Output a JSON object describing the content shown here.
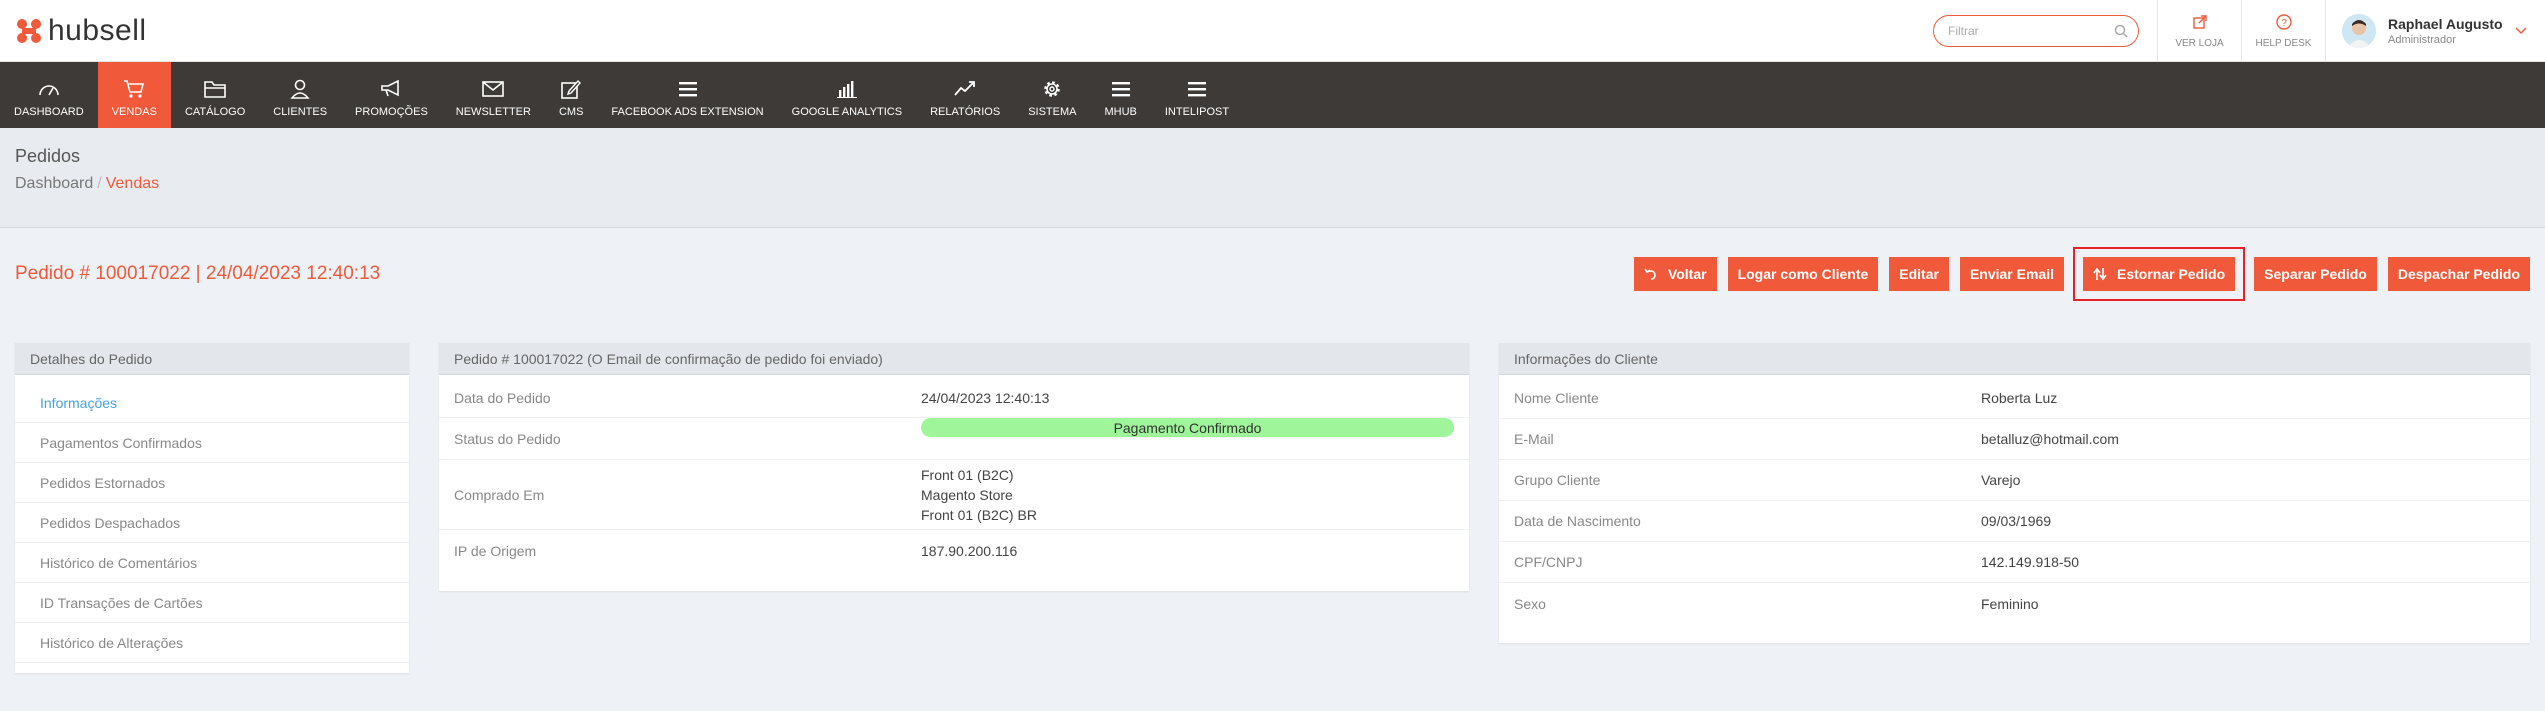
{
  "header": {
    "logo_text": "hubsell",
    "search_placeholder": "Filtrar",
    "ver_loja": "VER LOJA",
    "help_desk": "HELP DESK",
    "user_name": "Raphael Augusto",
    "user_role": "Administrador"
  },
  "nav": {
    "items": [
      {
        "label": "DASHBOARD",
        "icon": "dashboard-icon"
      },
      {
        "label": "VENDAS",
        "icon": "cart-icon"
      },
      {
        "label": "CATÁLOGO",
        "icon": "folder-icon"
      },
      {
        "label": "CLIENTES",
        "icon": "user-icon"
      },
      {
        "label": "PROMOÇÕES",
        "icon": "megaphone-icon"
      },
      {
        "label": "NEWSLETTER",
        "icon": "envelope-icon"
      },
      {
        "label": "CMS",
        "icon": "edit-icon"
      },
      {
        "label": "FACEBOOK ADS EXTENSION",
        "icon": "menu-icon"
      },
      {
        "label": "GOOGLE ANALYTICS",
        "icon": "bar-chart-icon"
      },
      {
        "label": "RELATÓRIOS",
        "icon": "line-chart-icon"
      },
      {
        "label": "SISTEMA",
        "icon": "gear-icon"
      },
      {
        "label": "MHUB",
        "icon": "menu-icon"
      },
      {
        "label": "INTELIPOST",
        "icon": "menu-icon"
      }
    ]
  },
  "page": {
    "title": "Pedidos",
    "breadcrumb_root": "Dashboard",
    "breadcrumb_sep": "/",
    "breadcrumb_current": "Vendas"
  },
  "order": {
    "title": "Pedido # 100017022 | 24/04/2023 12:40:13",
    "buttons": {
      "voltar": "Voltar",
      "logar": "Logar como Cliente",
      "editar": "Editar",
      "enviar_email": "Enviar Email",
      "estornar": "Estornar Pedido",
      "separar": "Separar Pedido",
      "despachar": "Despachar Pedido"
    }
  },
  "sidebar": {
    "title": "Detalhes do Pedido",
    "items": [
      "Informações",
      "Pagamentos Confirmados",
      "Pedidos Estornados",
      "Pedidos Despachados",
      "Histórico de Comentários",
      "ID Transações de Cartões",
      "Histórico de Alterações"
    ]
  },
  "order_panel": {
    "title": "Pedido # 100017022 (O Email de confirmação de pedido foi enviado)",
    "data_label": "Data do Pedido",
    "data_value": "24/04/2023 12:40:13",
    "status_label": "Status do Pedido",
    "status_value": "Pagamento Confirmado",
    "comprado_label": "Comprado Em",
    "comprado_lines": [
      "Front 01 (B2C)",
      "Magento Store",
      "Front 01 (B2C) BR"
    ],
    "ip_label": "IP de Origem",
    "ip_value": "187.90.200.116"
  },
  "client_panel": {
    "title": "Informações do Cliente",
    "rows": [
      {
        "label": "Nome Cliente",
        "value": "Roberta Luz"
      },
      {
        "label": "E-Mail",
        "value": "betalluz@hotmail.com"
      },
      {
        "label": "Grupo Cliente",
        "value": "Varejo"
      },
      {
        "label": "Data de Nascimento",
        "value": "09/03/1969"
      },
      {
        "label": "CPF/CNPJ",
        "value": "142.149.918-50"
      },
      {
        "label": "Sexo",
        "value": "Feminino"
      }
    ]
  },
  "colors": {
    "accent": "#f05a3a",
    "nav_bg": "#3d3a37",
    "status_green": "#9ef59a",
    "link_blue": "#45a3e0"
  }
}
